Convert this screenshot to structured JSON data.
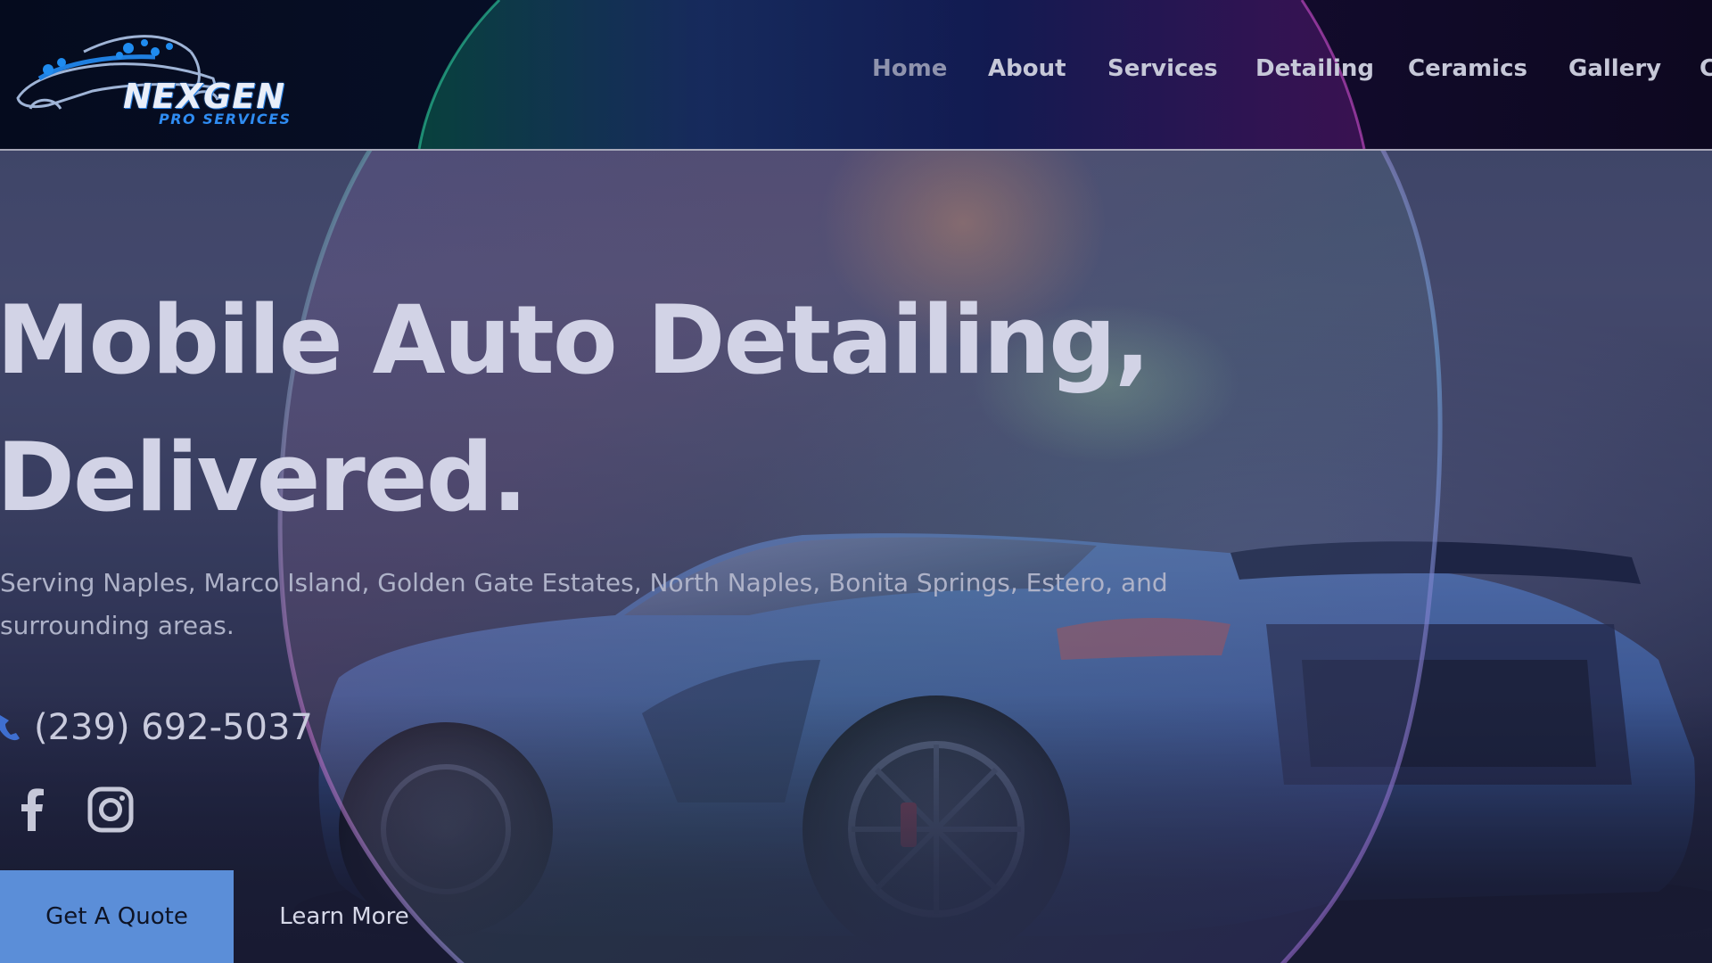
{
  "brand": {
    "logo_alt": "NEXGEN PRO SERVICES",
    "name": "NEXGEN",
    "tagline": "PRO SERVICES",
    "colors": {
      "primary_blue": "#2f8cf2",
      "header_bg": "#07102a",
      "button_bg": "#5b8ed8"
    }
  },
  "nav": {
    "items": [
      {
        "label": "Home",
        "active": true
      },
      {
        "label": "About"
      },
      {
        "label": "Services"
      },
      {
        "label": "Detailing"
      },
      {
        "label": "Ceramics"
      },
      {
        "label": "Gallery"
      },
      {
        "label": "C"
      }
    ]
  },
  "hero": {
    "title_line1": "Mobile Auto Detailing,",
    "title_line2": "Delivered.",
    "subtitle": "Serving Naples, Marco Island, Golden Gate Estates, North Naples, Bonita Springs, Estero, and surrounding areas.",
    "phone": "(239) 692-5037",
    "phone_icon": "phone-icon",
    "social": [
      {
        "icon": "facebook-icon"
      },
      {
        "icon": "instagram-icon"
      }
    ],
    "cta_primary": "Get A Quote",
    "cta_secondary": "Learn More"
  }
}
